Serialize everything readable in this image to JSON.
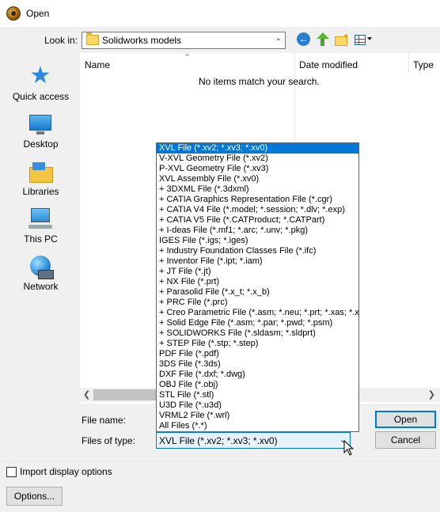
{
  "window": {
    "title": "Open"
  },
  "toolbar": {
    "look_in_label": "Look in:",
    "look_in_value": "Solidworks models",
    "back_icon": "back-arrow-icon",
    "up_icon": "up-folder-icon",
    "new_folder_icon": "new-folder-icon",
    "views_icon": "views-menu-icon"
  },
  "places": [
    {
      "label": "Quick access",
      "icon": "quick-access-star-icon"
    },
    {
      "label": "Desktop",
      "icon": "desktop-icon"
    },
    {
      "label": "Libraries",
      "icon": "libraries-icon"
    },
    {
      "label": "This PC",
      "icon": "this-pc-icon"
    },
    {
      "label": "Network",
      "icon": "network-icon"
    }
  ],
  "file_list": {
    "columns": [
      "Name",
      "Date modified",
      "Type"
    ],
    "empty_message": "No items match your search."
  },
  "form": {
    "file_name_label": "File name:",
    "file_name_value": "",
    "files_of_type_label": "Files of type:",
    "files_of_type_value": "XVL File (*.xv2; *.xv3; *.xv0)",
    "open_label": "Open",
    "cancel_label": "Cancel"
  },
  "file_type_options": [
    "XVL File (*.xv2; *.xv3; *.xv0)",
    "V-XVL Geometry File (*.xv2)",
    "P-XVL Geometry File (*.xv3)",
    "XVL Assembly File (*.xv0)",
    "+ 3DXML File (*.3dxml)",
    "+ CATIA Graphics Representation File (*.cgr)",
    "+ CATIA V4 File (*.model; *.session; *.dlv; *.exp)",
    "+ CATIA V5 File (*.CATProduct; *.CATPart)",
    "+ I-deas File (*.mf1; *.arc; *.unv; *.pkg)",
    "IGES File (*.igs; *.iges)",
    "+ Industry Foundation Classes File (*.ifc)",
    "+ Inventor File (*.ipt; *.iam)",
    "+ JT File (*.jt)",
    "+ NX File (*.prt)",
    "+ Parasolid File (*.x_t; *.x_b)",
    "+ PRC File (*.prc)",
    "+ Creo Parametric File (*.asm; *.neu; *.prt; *.xas; *.xpr)",
    "+ Solid Edge File (*.asm; *.par; *.pwd; *.psm)",
    "+ SOLIDWORKS File (*.sldasm; *.sldprt)",
    "+ STEP File (*.stp; *.step)",
    "PDF File (*.pdf)",
    "3DS File (*.3ds)",
    "DXF File (*.dxf; *.dwg)",
    "OBJ File (*.obj)",
    "STL File (*.stl)",
    "U3D File (*.u3d)",
    "VRML2 File (*.wrl)",
    "All Files (*.*)"
  ],
  "footer": {
    "import_display_options_label": "Import display options",
    "import_display_options_checked": false,
    "options_button_label": "Options..."
  }
}
